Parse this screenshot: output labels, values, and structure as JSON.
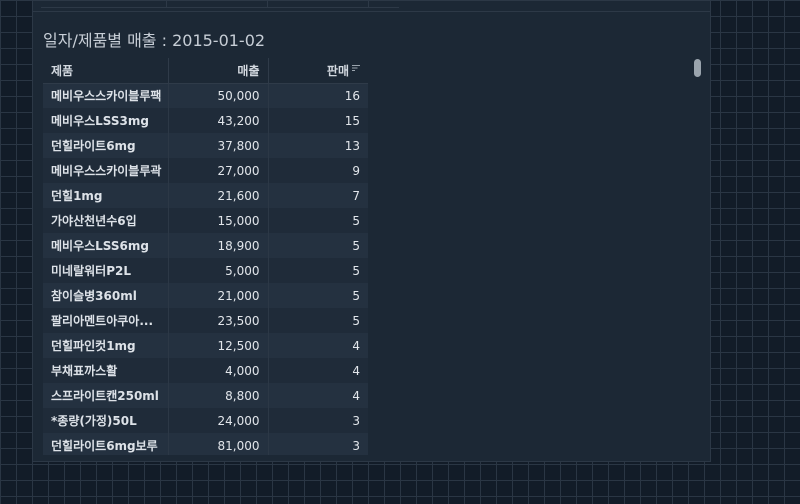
{
  "widget": {
    "title": "일자/제품별 매출 : 2015-01-02",
    "columns": {
      "product": "제품",
      "sales": "매출",
      "qty": "판매"
    },
    "rows": [
      {
        "product": "메비우스스카이블루팩",
        "sales": "50,000",
        "qty": "16"
      },
      {
        "product": "메비우스LSS3mg",
        "sales": "43,200",
        "qty": "15"
      },
      {
        "product": "던힐라이트6mg",
        "sales": "37,800",
        "qty": "13"
      },
      {
        "product": "메비우스스카이블루곽",
        "sales": "27,000",
        "qty": "9"
      },
      {
        "product": "던힐1mg",
        "sales": "21,600",
        "qty": "7"
      },
      {
        "product": "가야산천년수6입",
        "sales": "15,000",
        "qty": "5"
      },
      {
        "product": "메비우스LSS6mg",
        "sales": "18,900",
        "qty": "5"
      },
      {
        "product": "미네랄워터P2L",
        "sales": "5,000",
        "qty": "5"
      },
      {
        "product": "참이슬병360ml",
        "sales": "21,000",
        "qty": "5"
      },
      {
        "product": "팔리아멘트아쿠아...",
        "sales": "23,500",
        "qty": "5"
      },
      {
        "product": "던힐파인컷1mg",
        "sales": "12,500",
        "qty": "4"
      },
      {
        "product": "부채표까스활",
        "sales": "4,000",
        "qty": "4"
      },
      {
        "product": "스프라이트캔250ml",
        "sales": "8,800",
        "qty": "4"
      },
      {
        "product": "*종량(가정)50L",
        "sales": "24,000",
        "qty": "3"
      },
      {
        "product": "던힐라이트6mg보루",
        "sales": "81,000",
        "qty": "3"
      }
    ]
  },
  "sort_icon": "sort-descending-icon"
}
